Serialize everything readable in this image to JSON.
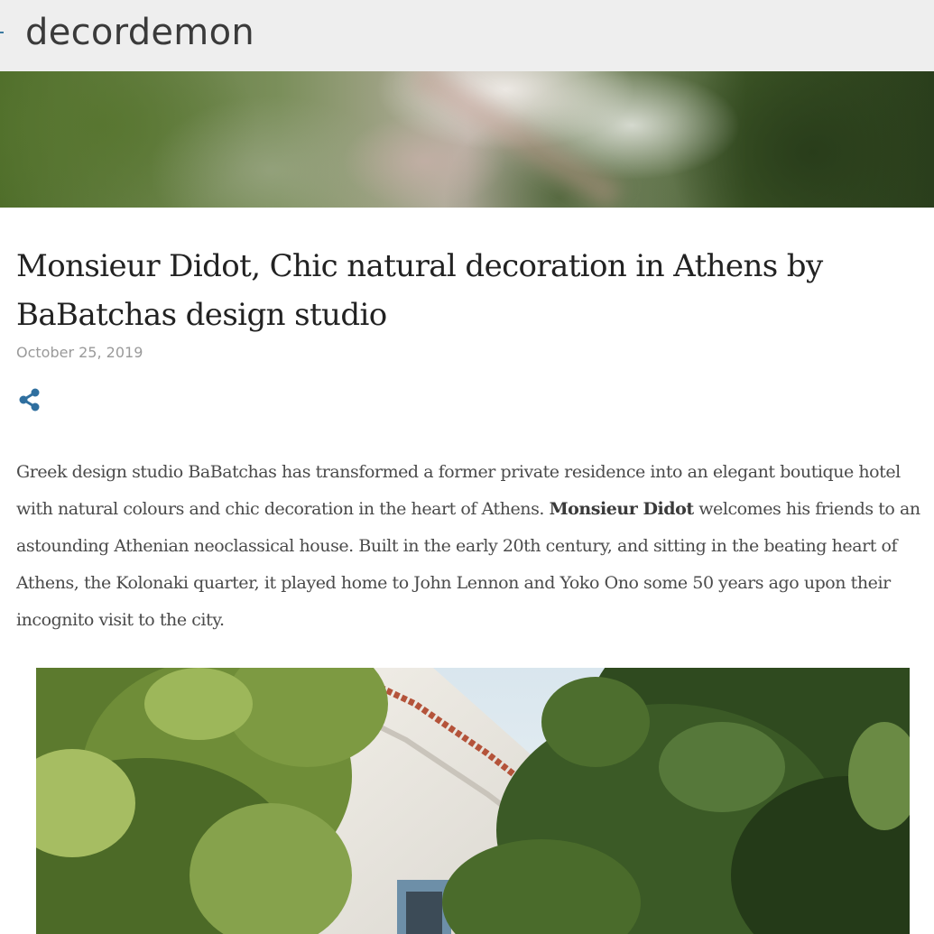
{
  "header": {
    "site_title": "decordemon"
  },
  "post": {
    "title": "Monsieur Didot, Chic natural decoration in Athens by BaBatchas design studio",
    "date": "October 25, 2019",
    "share_icon": "share-icon",
    "body": {
      "part1": "Greek design studio BaBatchas has transformed a former private residence into an elegant boutique hotel with natural colours and chic decoration in the heart of Athens. ",
      "bold": "Monsieur Didot",
      "part2": " welcomes his friends to an astounding Athenian neoclassical house. Built in the early 20th century, and sitting in the beating heart of Athens, the Kolonaki quarter, it played home to John Lennon and Yoko Ono some 50 years ago upon their incognito visit to the city."
    }
  },
  "colors": {
    "header_bg": "#eeeeee",
    "accent": "#2f6f9f",
    "text": "#4a4a4a",
    "date": "#9a9a9a"
  }
}
